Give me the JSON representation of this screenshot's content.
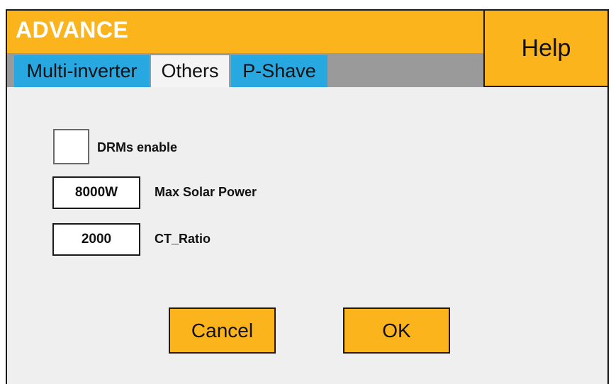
{
  "window": {
    "title": "ADVANCE",
    "help_label": "Help"
  },
  "tabs": [
    {
      "label": "Multi-inverter",
      "active": false
    },
    {
      "label": "Others",
      "active": true
    },
    {
      "label": "P-Shave",
      "active": false
    }
  ],
  "settings": {
    "drms": {
      "label": "DRMs enable",
      "checked": false
    },
    "max_solar_power": {
      "label": "Max Solar Power",
      "value": "8000W"
    },
    "ct_ratio": {
      "label": "CT_Ratio",
      "value": "2000"
    }
  },
  "buttons": {
    "cancel_label": "Cancel",
    "ok_label": "OK"
  },
  "colors": {
    "accent": "#fcb41c",
    "tab_blue": "#28a8e0",
    "tab_bar": "#9a9a9a",
    "panel": "#efefef"
  }
}
